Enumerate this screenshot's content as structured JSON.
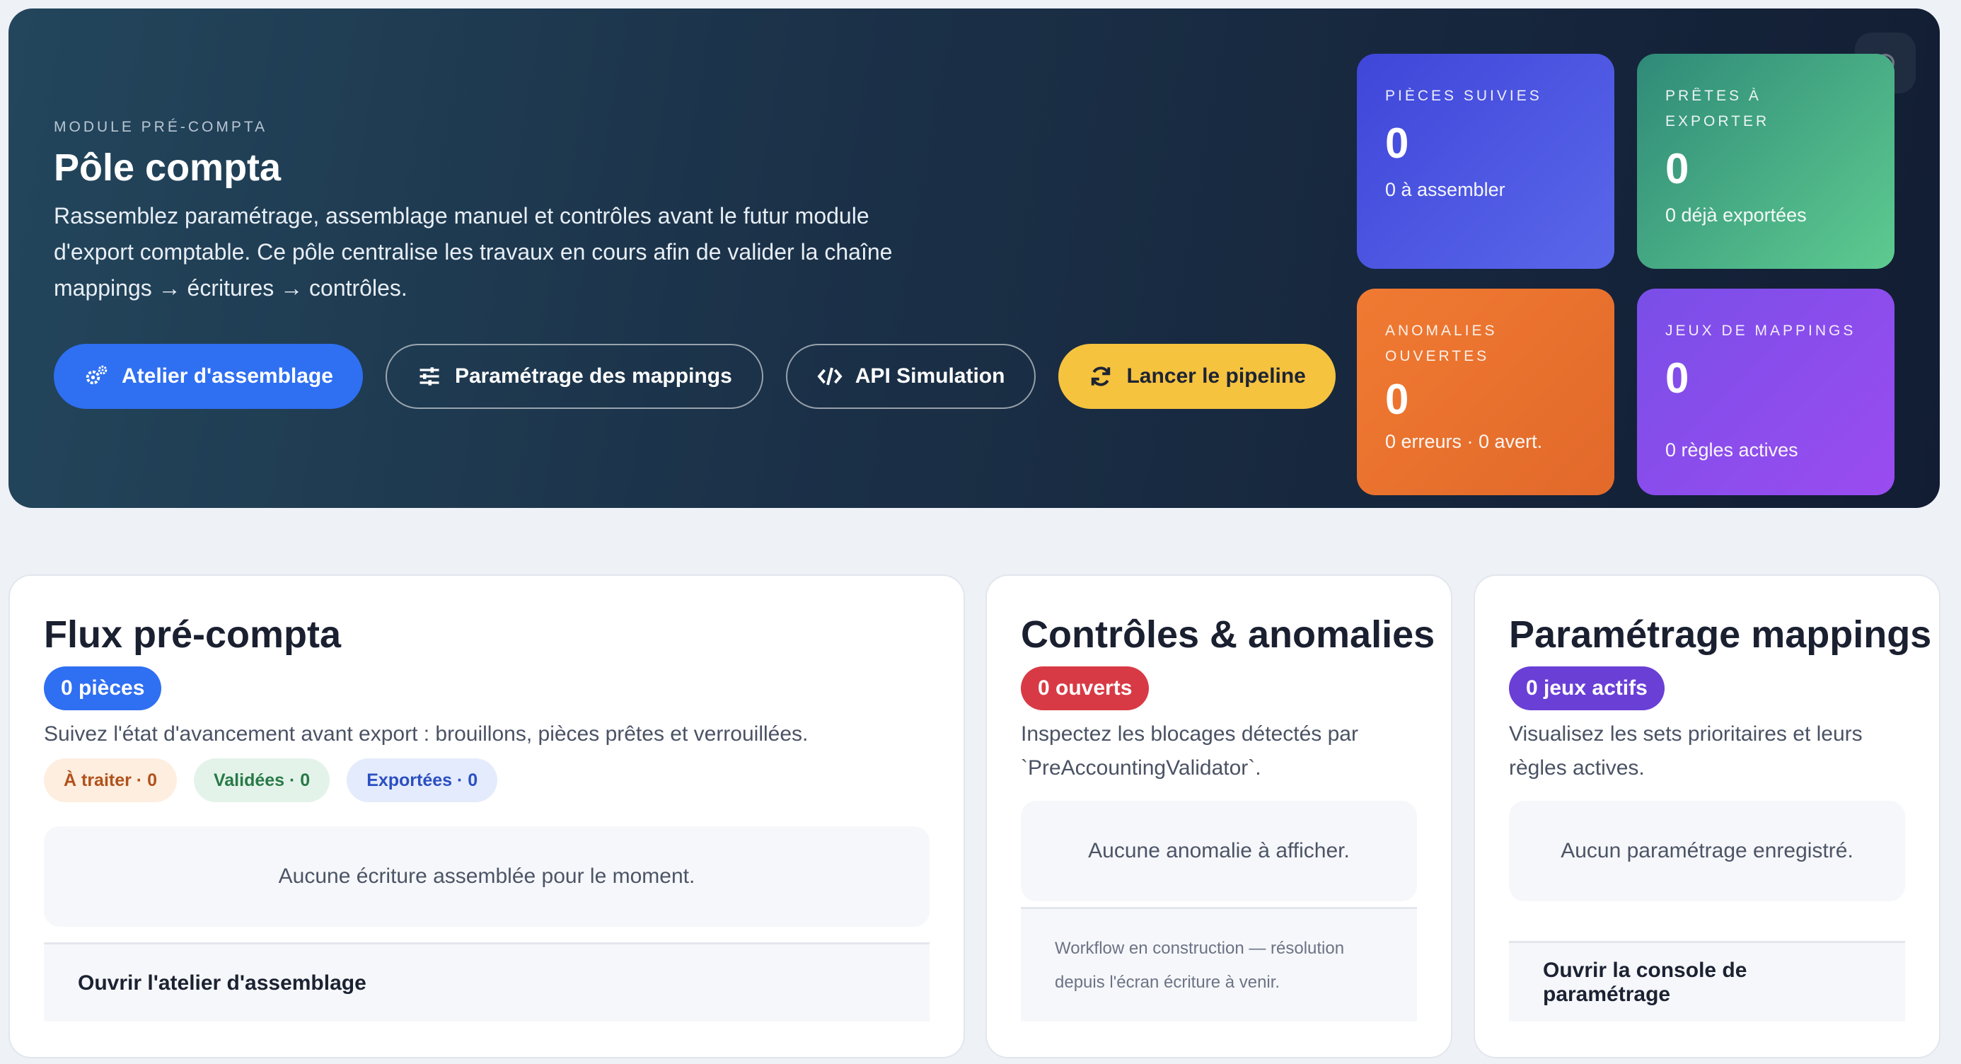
{
  "hero": {
    "eyebrow": "MODULE PRÉ-COMPTA",
    "title": "Pôle compta",
    "description": "Rassemblez paramétrage, assemblage manuel et contrôles avant le futur module d'export comptable. Ce pôle centralise les travaux en cours afin de valider la chaîne mappings → écritures → contrôles.",
    "actions": [
      {
        "label": "Atelier d'assemblage",
        "icon": "gears-icon",
        "style": "primary"
      },
      {
        "label": "Paramétrage des mappings",
        "icon": "sliders-icon",
        "style": "outline"
      },
      {
        "label": "API Simulation",
        "icon": "code-icon",
        "style": "outline"
      },
      {
        "label": "Lancer le pipeline",
        "icon": "refresh-icon",
        "style": "yellow"
      }
    ]
  },
  "stats": [
    {
      "label": "PIÈCES SUIVIES",
      "value": "0",
      "sub": "0 à assembler",
      "color": "#4a52e0"
    },
    {
      "label": "PRÊTES À EXPORTER",
      "value": "0",
      "sub": "0 déjà exportées",
      "color": "#47a98a"
    },
    {
      "label": "ANOMALIES OUVERTES",
      "value": "0",
      "sub": "0 erreurs · 0 avert.",
      "color": "#ea7230"
    },
    {
      "label": "JEUX DE MAPPINGS",
      "value": "0",
      "sub": "0 règles actives",
      "color": "#8a4dec"
    }
  ],
  "cards": {
    "flux": {
      "title": "Flux pré-compta",
      "badge": "0 pièces",
      "description": "Suivez l'état d'avancement avant export : brouillons, pièces prêtes et verrouillées.",
      "chips": [
        "À traiter · 0",
        "Validées · 0",
        "Exportées · 0"
      ],
      "empty": "Aucune écriture assemblée pour le moment.",
      "footer": "Ouvrir l'atelier d'assemblage"
    },
    "controles": {
      "title": "Contrôles & anomalies",
      "badge": "0 ouverts",
      "description": "Inspectez les blocages détectés par `PreAccountingValidator`.",
      "empty": "Aucune anomalie à afficher.",
      "footer_note": "Workflow en construction — résolution depuis l'écran écriture à venir."
    },
    "mappings": {
      "title": "Paramétrage mappings",
      "badge": "0 jeux actifs",
      "description": "Visualisez les sets prioritaires et leurs règles actives.",
      "empty": "Aucun paramétrage enregistré.",
      "footer": "Ouvrir la console de paramétrage"
    }
  }
}
